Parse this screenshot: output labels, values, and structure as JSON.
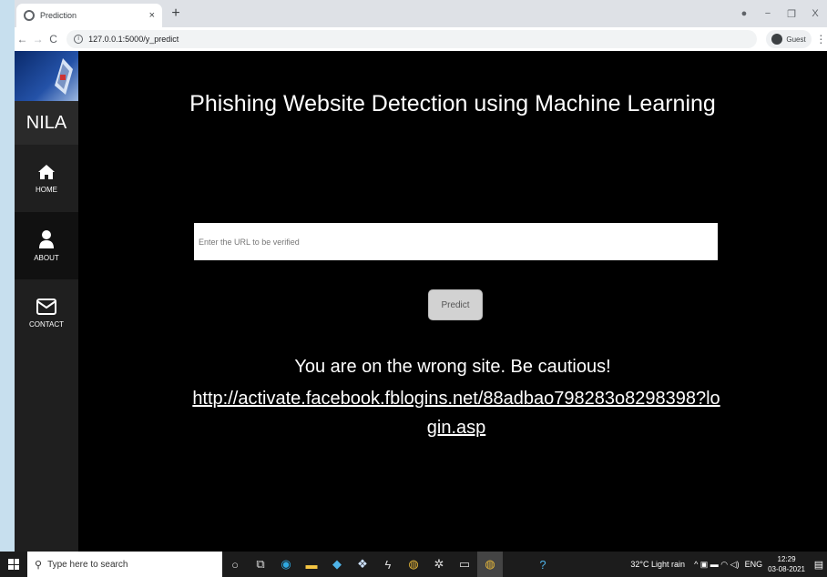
{
  "browser": {
    "tab_title": "Prediction",
    "tab_close": "×",
    "new_tab": "+",
    "url": "127.0.0.1:5000/y_predict",
    "profile_label": "Guest",
    "back": "←",
    "forward": "→",
    "reload": "C",
    "menu": "⋮",
    "minimize": "−",
    "restore": "❐",
    "close": "X"
  },
  "sidebar": {
    "brand": "NILA",
    "items": [
      {
        "label": "HOME",
        "icon": "home-icon"
      },
      {
        "label": "ABOUT",
        "icon": "user-icon"
      },
      {
        "label": "CONTACT",
        "icon": "envelope-icon"
      }
    ]
  },
  "main": {
    "title": "Phishing Website Detection using Machine Learning",
    "input_placeholder": "Enter the URL to be verified",
    "predict_label": "Predict",
    "result_text": "You are on the wrong site. Be cautious!",
    "result_url": "http://activate.facebook.fblogins.net/88adbao798283o8298398?login.asp"
  },
  "taskbar": {
    "search_text": "Type here to search",
    "weather": "32°C  Light rain",
    "lang": "ENG",
    "time": "12:29",
    "date": "03-08-2021"
  },
  "colors": {
    "page_bg": "#000000",
    "sidebar_bg": "#1f1f1f",
    "text": "#ffffff"
  }
}
